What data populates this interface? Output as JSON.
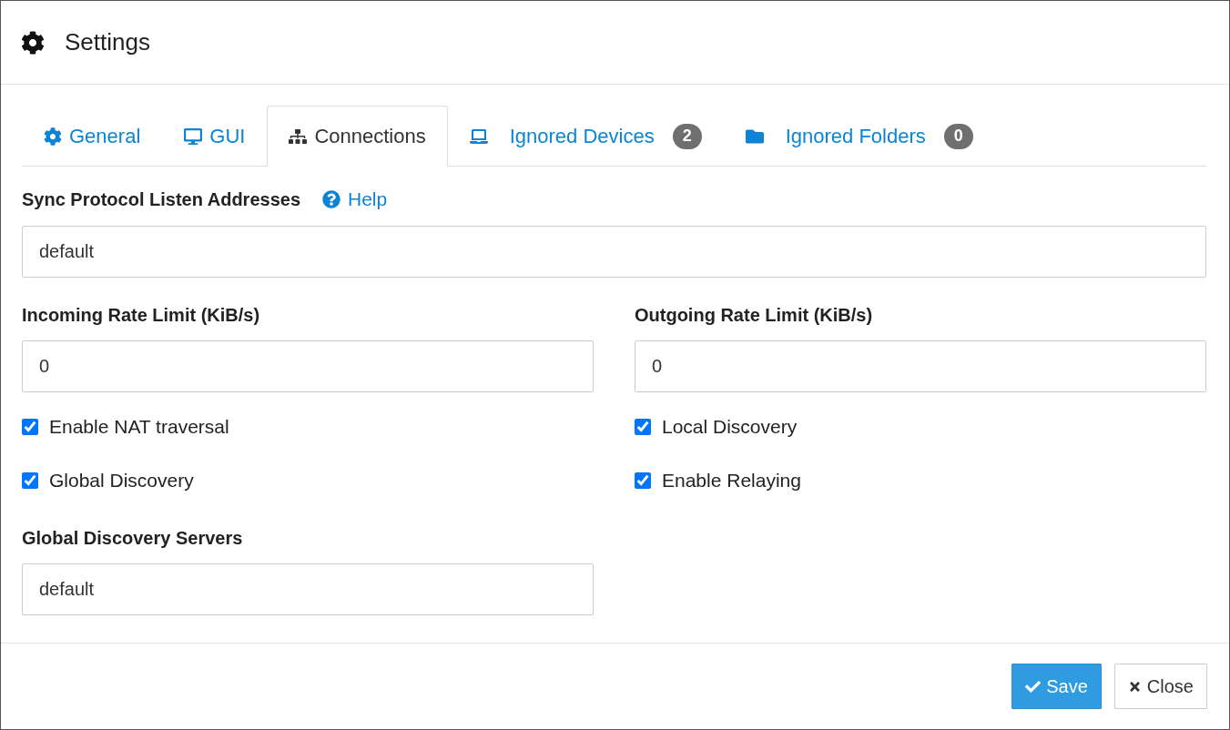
{
  "dialog": {
    "title": "Settings"
  },
  "tabs": [
    {
      "label": "General",
      "selected": false
    },
    {
      "label": "GUI",
      "selected": false
    },
    {
      "label": "Connections",
      "selected": true
    },
    {
      "label": "Ignored Devices",
      "selected": false,
      "badge": "2"
    },
    {
      "label": "Ignored Folders",
      "selected": false,
      "badge": "0"
    }
  ],
  "listen_addresses": {
    "label": "Sync Protocol Listen Addresses",
    "help": "Help",
    "value": "default"
  },
  "rate_limits": [
    {
      "label": "Incoming Rate Limit (KiB/s)",
      "value": "0"
    },
    {
      "label": "Outgoing Rate Limit (KiB/s)",
      "value": "0"
    }
  ],
  "checkboxes": [
    {
      "label": "Enable NAT traversal",
      "checked": true
    },
    {
      "label": "Local Discovery",
      "checked": true
    },
    {
      "label": "Global Discovery",
      "checked": true
    },
    {
      "label": "Enable Relaying",
      "checked": true
    }
  ],
  "discovery_servers": {
    "label": "Global Discovery Servers",
    "value": "default"
  },
  "buttons": [
    {
      "label": "Save",
      "kind": "primary"
    },
    {
      "label": "Close",
      "kind": "default"
    }
  ]
}
